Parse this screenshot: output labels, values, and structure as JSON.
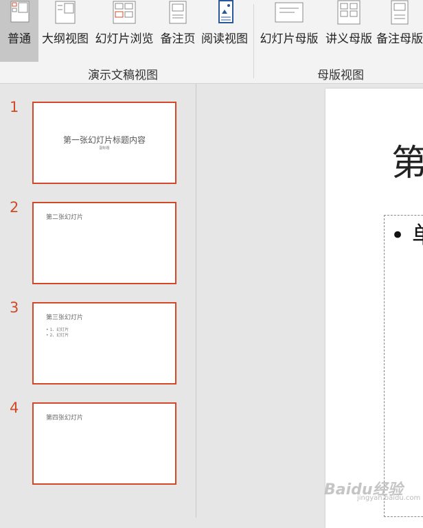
{
  "ribbon": {
    "groups": [
      {
        "label": "演示文稿视图"
      },
      {
        "label": "母版视图"
      }
    ],
    "buttons": [
      {
        "label": "普通"
      },
      {
        "label": "大纲视图"
      },
      {
        "label": "幻灯片浏览"
      },
      {
        "label": "备注页"
      },
      {
        "label": "阅读视图"
      },
      {
        "label": "幻灯片母版"
      },
      {
        "label": "讲义母版"
      },
      {
        "label": "备注母版"
      }
    ]
  },
  "thumbnails": [
    {
      "number": "1",
      "title": "第一张幻灯片标题内容",
      "subtitle": "副标题"
    },
    {
      "number": "2",
      "title": "第二张幻灯片"
    },
    {
      "number": "3",
      "title": "第三张幻灯片",
      "bullets": [
        "• 1、幻灯片",
        "• 2、幻灯片"
      ]
    },
    {
      "number": "4",
      "title": "第四张幻灯片"
    }
  ],
  "editor": {
    "title_partial": "第",
    "bullet_partial": "• 单"
  },
  "watermark": {
    "text": "Baidu经验",
    "sub": "jingyan.baidu.com"
  },
  "colors": {
    "accent": "#d24726",
    "ribbon_bg": "#f3f3f3",
    "pane_bg": "#e6e6e6"
  }
}
